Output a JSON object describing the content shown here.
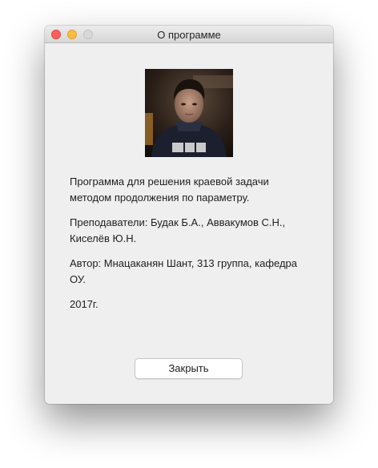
{
  "window": {
    "title": "О программе"
  },
  "photo": {
    "description_icon": "author-photo"
  },
  "about": {
    "description": "Программа для решения краевой задачи методом продолжения по параметру.",
    "teachers": "Преподаватели: Будак Б.А., Аввакумов С.Н., Киселёв Ю.Н.",
    "author": "Автор: Мнацаканян Шант, 313 группа, кафедра ОУ.",
    "year": "2017г."
  },
  "buttons": {
    "close_label": "Закрыть"
  },
  "colors": {
    "close": "#fc605c",
    "minimize": "#fdbc40",
    "zoom": "#d8d8d8",
    "window_bg": "#efefef"
  }
}
